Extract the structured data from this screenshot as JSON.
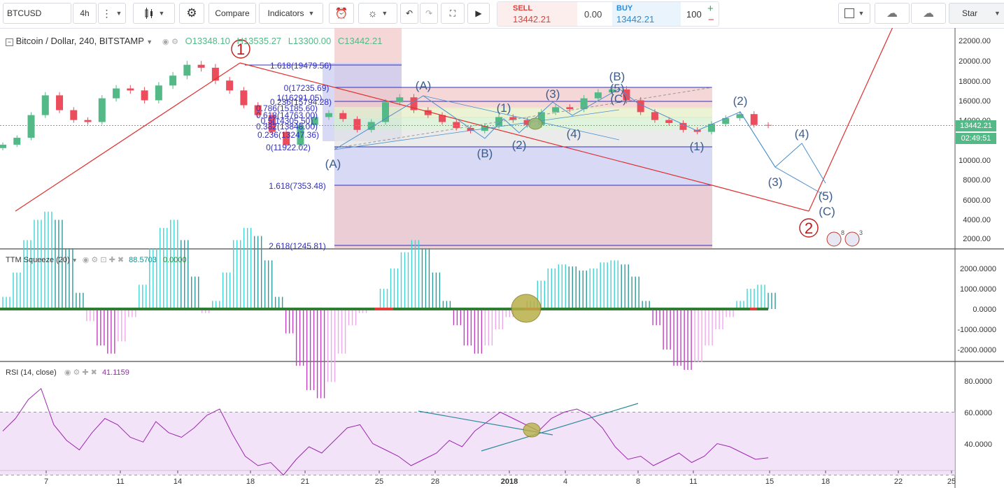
{
  "toolbar": {
    "symbol": "BTCUSD",
    "interval": "4h",
    "compare_label": "Compare",
    "indicators_label": "Indicators",
    "start_label": "Star"
  },
  "trade": {
    "sell_label": "SELL",
    "sell_price": "13442.21",
    "spread": "0.00",
    "buy_label": "BUY",
    "buy_price": "13442.21",
    "quantity": "100"
  },
  "legend": {
    "title": "Bitcoin / Dollar, 240, BITSTAMP",
    "open": "O13348.10",
    "high": "H13535.27",
    "low": "L13300.00",
    "close": "C13442.21",
    "ttm_name": "TTM Squeeze (20)",
    "ttm_v1": "88.5703",
    "ttm_v2": "0.0000",
    "rsi_name": "RSI (14, close)",
    "rsi_v": "41.1159",
    "price_badge": "13442.21",
    "time_badge": "02:49:51"
  },
  "colors": {
    "up": "#53b987",
    "down": "#eb4d5c",
    "wave": "#4a8fcd",
    "trend": "#e03030",
    "rsi": "#9c27b0",
    "fib_blue": "#3030c0"
  },
  "chart_data": [
    {
      "type": "line",
      "title": "Bitcoin / Dollar, 240, BITSTAMP",
      "x_ticks": [
        "7",
        "11",
        "14",
        "18",
        "21",
        "25",
        "28",
        "2018",
        "4",
        "8",
        "11",
        "15",
        "18",
        "22",
        "25"
      ],
      "y_ticks": [
        "22000.00",
        "20000.00",
        "18000.00",
        "16000.00",
        "14000.00",
        "12000.00",
        "10000.00",
        "8000.00",
        "6000.00",
        "4000.00",
        "2000.00"
      ],
      "ylim": [
        1000,
        22500
      ],
      "series": [
        {
          "values": [
            11500,
            12200,
            14500,
            16500,
            15000,
            14000,
            13800,
            16200,
            17200,
            17000,
            16000,
            17500,
            18500,
            19600,
            19300,
            18000,
            17000,
            15500,
            14500,
            12800,
            11500,
            13500,
            14300,
            14700,
            14100,
            13000,
            13800,
            15800,
            16300,
            15000,
            14500,
            13800,
            13200,
            12900,
            13400,
            14300,
            14000,
            13500,
            14800,
            15300,
            15100,
            16200,
            16800,
            17100,
            16000,
            14800,
            14000,
            13700,
            13000,
            12800,
            13600,
            14200,
            14600,
            13500,
            13442
          ]
        }
      ],
      "fib_left": [
        "1.618(19479.56)",
        "0(17235.69)",
        "1(16291.05)",
        "0.236(15794.28)",
        "0.786(15185.60)",
        "0.618(14763.00)",
        "0.5(14305.50)",
        "0.382(13848.00)",
        "0.236(13247.36)",
        "0(11922.02)"
      ],
      "fib_right": [
        "1.618(7353.48)",
        "2.618(1245.81)"
      ],
      "wave_labels": [
        "(A)",
        "(A)",
        "(B)",
        "(1)",
        "(2)",
        "(3)",
        "(4)",
        "(B)",
        "(5)",
        "(C)",
        "(1)",
        "(2)",
        "(3)",
        "(4)",
        "(5)",
        "(C)",
        "1",
        "2"
      ],
      "badges": [
        "8",
        "3"
      ]
    },
    {
      "type": "bar",
      "title": "TTM Squeeze (20)",
      "y_ticks": [
        "2000.0000",
        "1000.0000",
        "0.0000",
        "-1000.0000",
        "-2000.0000"
      ],
      "ylim": [
        -2500,
        2500
      ],
      "values": [
        300,
        900,
        1700,
        2200,
        2400,
        2200,
        1500,
        400,
        -300,
        -900,
        -1100,
        -800,
        -200,
        600,
        1500,
        2000,
        2200,
        1700,
        800,
        -100,
        200,
        900,
        1700,
        2000,
        1800,
        1200,
        300,
        -600,
        -1400,
        -2000,
        -2200,
        -1800,
        -1100,
        -400,
        -100,
        0,
        500,
        1000,
        1400,
        1700,
        1500,
        900,
        200,
        -400,
        -900,
        -1100,
        -900,
        -500,
        -200,
        0,
        200,
        700,
        1000,
        1100,
        1050,
        950,
        1000,
        1150,
        1200,
        1100,
        800,
        200,
        -400,
        -1000,
        -1400,
        -1500,
        -1300,
        -900,
        -500,
        -200,
        200,
        500,
        600,
        400
      ]
    },
    {
      "type": "line",
      "title": "RSI (14, close)",
      "y_ticks": [
        "80.0000",
        "60.0000",
        "40.0000"
      ],
      "ylim": [
        22,
        92
      ],
      "bands": [
        70,
        30
      ],
      "values": [
        58,
        66,
        78,
        85,
        62,
        52,
        46,
        57,
        66,
        62,
        54,
        51,
        64,
        57,
        54,
        60,
        68,
        72,
        56,
        42,
        36,
        38,
        30,
        40,
        48,
        44,
        52,
        60,
        62,
        50,
        46,
        42,
        36,
        40,
        44,
        52,
        48,
        58,
        64,
        70,
        66,
        62,
        58,
        66,
        70,
        72,
        68,
        60,
        48,
        40,
        42,
        36,
        40,
        44,
        38,
        42,
        50,
        48,
        44,
        40,
        41
      ]
    }
  ]
}
